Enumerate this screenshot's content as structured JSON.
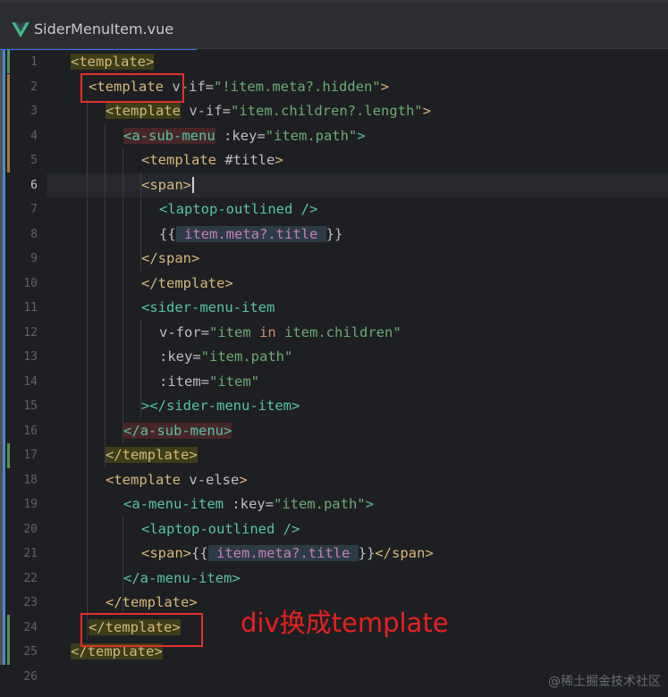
{
  "tab": {
    "filename": "SiderMenuItem.vue",
    "icon": "vue-icon"
  },
  "gutter": {
    "line_numbers": [
      "1",
      "2",
      "3",
      "4",
      "5",
      "6",
      "7",
      "8",
      "9",
      "10",
      "11",
      "12",
      "13",
      "14",
      "15",
      "16",
      "17",
      "18",
      "19",
      "20",
      "21",
      "22",
      "23",
      "24",
      "25",
      "26"
    ],
    "current_line": "6"
  },
  "code": {
    "l1_t": "<template>",
    "l2_t": "<template",
    "l2_a": " v-if=",
    "l2_s": "\"!item.meta?.hidden\"",
    "l2_e": ">",
    "l3_t": "<template",
    "l3_a": " v-if=",
    "l3_s": "\"item.children?.length\"",
    "l3_e": ">",
    "l4_t": "<a-sub-menu",
    "l4_a": " :key=",
    "l4_s": "\"item.path\"",
    "l4_e": ">",
    "l5_t": "<template",
    "l5_a": " #title",
    "l5_e": ">",
    "l6_t": "<span>",
    "l7_t": "<laptop-outlined",
    "l7_e": " />",
    "l8_o": "{{",
    "l8_x": " item.meta?.title ",
    "l8_c": "}}",
    "l9_t": "</span>",
    "l10_t": "</template>",
    "l11_t": "<sider-menu-item",
    "l12_a": "v-for=",
    "l12_s1": "\"item ",
    "l12_k": "in",
    "l12_s2": " item.children\"",
    "l13_a": ":key=",
    "l13_s": "\"item.path\"",
    "l14_a": ":item=",
    "l14_s": "\"item\"",
    "l15_t1": "></",
    "l15_n": "sider-menu-item",
    "l15_t2": ">",
    "l16_t": "</a-sub-menu>",
    "l17_t": "</template>",
    "l18_t": "<template",
    "l18_a": " v-else",
    "l18_e": ">",
    "l19_t": "<a-menu-item",
    "l19_a": " :key=",
    "l19_s": "\"item.path\"",
    "l19_e": ">",
    "l20_t": "<laptop-outlined",
    "l20_e": " />",
    "l21_t1": "<span>",
    "l21_o": "{{",
    "l21_x": " item.meta?.title ",
    "l21_c": "}}",
    "l21_t2": "</span>",
    "l22_t": "</a-menu-item>",
    "l23_t": "</template>",
    "l24_t": "</template>",
    "l25_t": "</template>"
  },
  "annotation": {
    "text": "div换成template"
  },
  "watermark": {
    "text": "@稀土掘金技术社区"
  },
  "colors": {
    "tag": "#d5b778",
    "component_tag": "#57c3a6",
    "string": "#6aab73",
    "expression": "#c77dbb",
    "keyword": "#cf8e6d",
    "annotation_red": "#e62020",
    "tab_underline": "#3574f0"
  }
}
